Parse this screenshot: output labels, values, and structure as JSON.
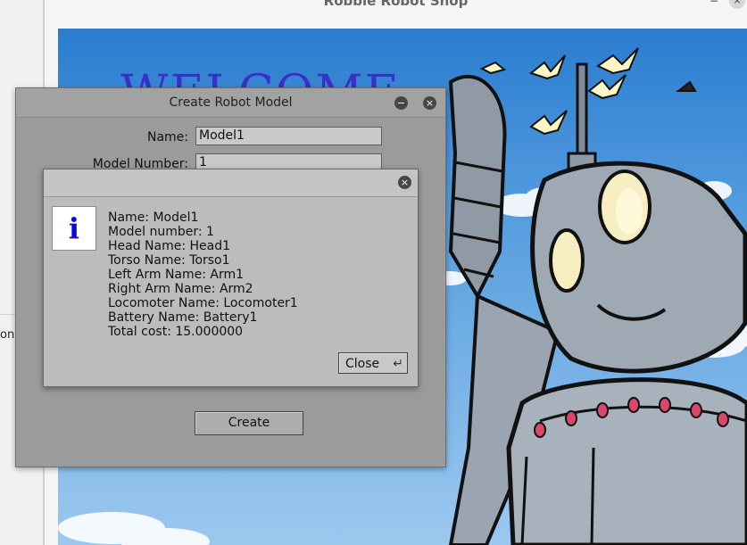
{
  "side_panel": {
    "text": "ons"
  },
  "main_window": {
    "title": "Robbie Robot Shop",
    "close_glyph": "×",
    "min_glyph": "−"
  },
  "canvas": {
    "welcome": "WELCOME"
  },
  "create_dialog": {
    "title": "Create Robot Model",
    "minimize_glyph": "−",
    "close_glyph": "×",
    "name_label": "Name:",
    "name_value": "Model1",
    "model_number_label": "Model Number:",
    "model_number_value": "1",
    "create_label": "Create"
  },
  "message_box": {
    "close_glyph": "×",
    "icon_glyph": "i",
    "lines": [
      "Name: Model1",
      "Model number: 1",
      "Head Name: Head1",
      "Torso Name: Torso1",
      "Left Arm Name: Arm1",
      "Right Arm Name: Arm2",
      "Locomoter Name: Locomoter1",
      "Battery Name: Battery1",
      "Total cost: 15.000000"
    ],
    "close_label": "Close",
    "enter_glyph": "↵"
  },
  "colors": {
    "sky_top": "#2a7ccf",
    "welcome": "#3a2fc8",
    "info_icon": "#0b0bd6",
    "dialog_bg": "#9b9b9b"
  }
}
